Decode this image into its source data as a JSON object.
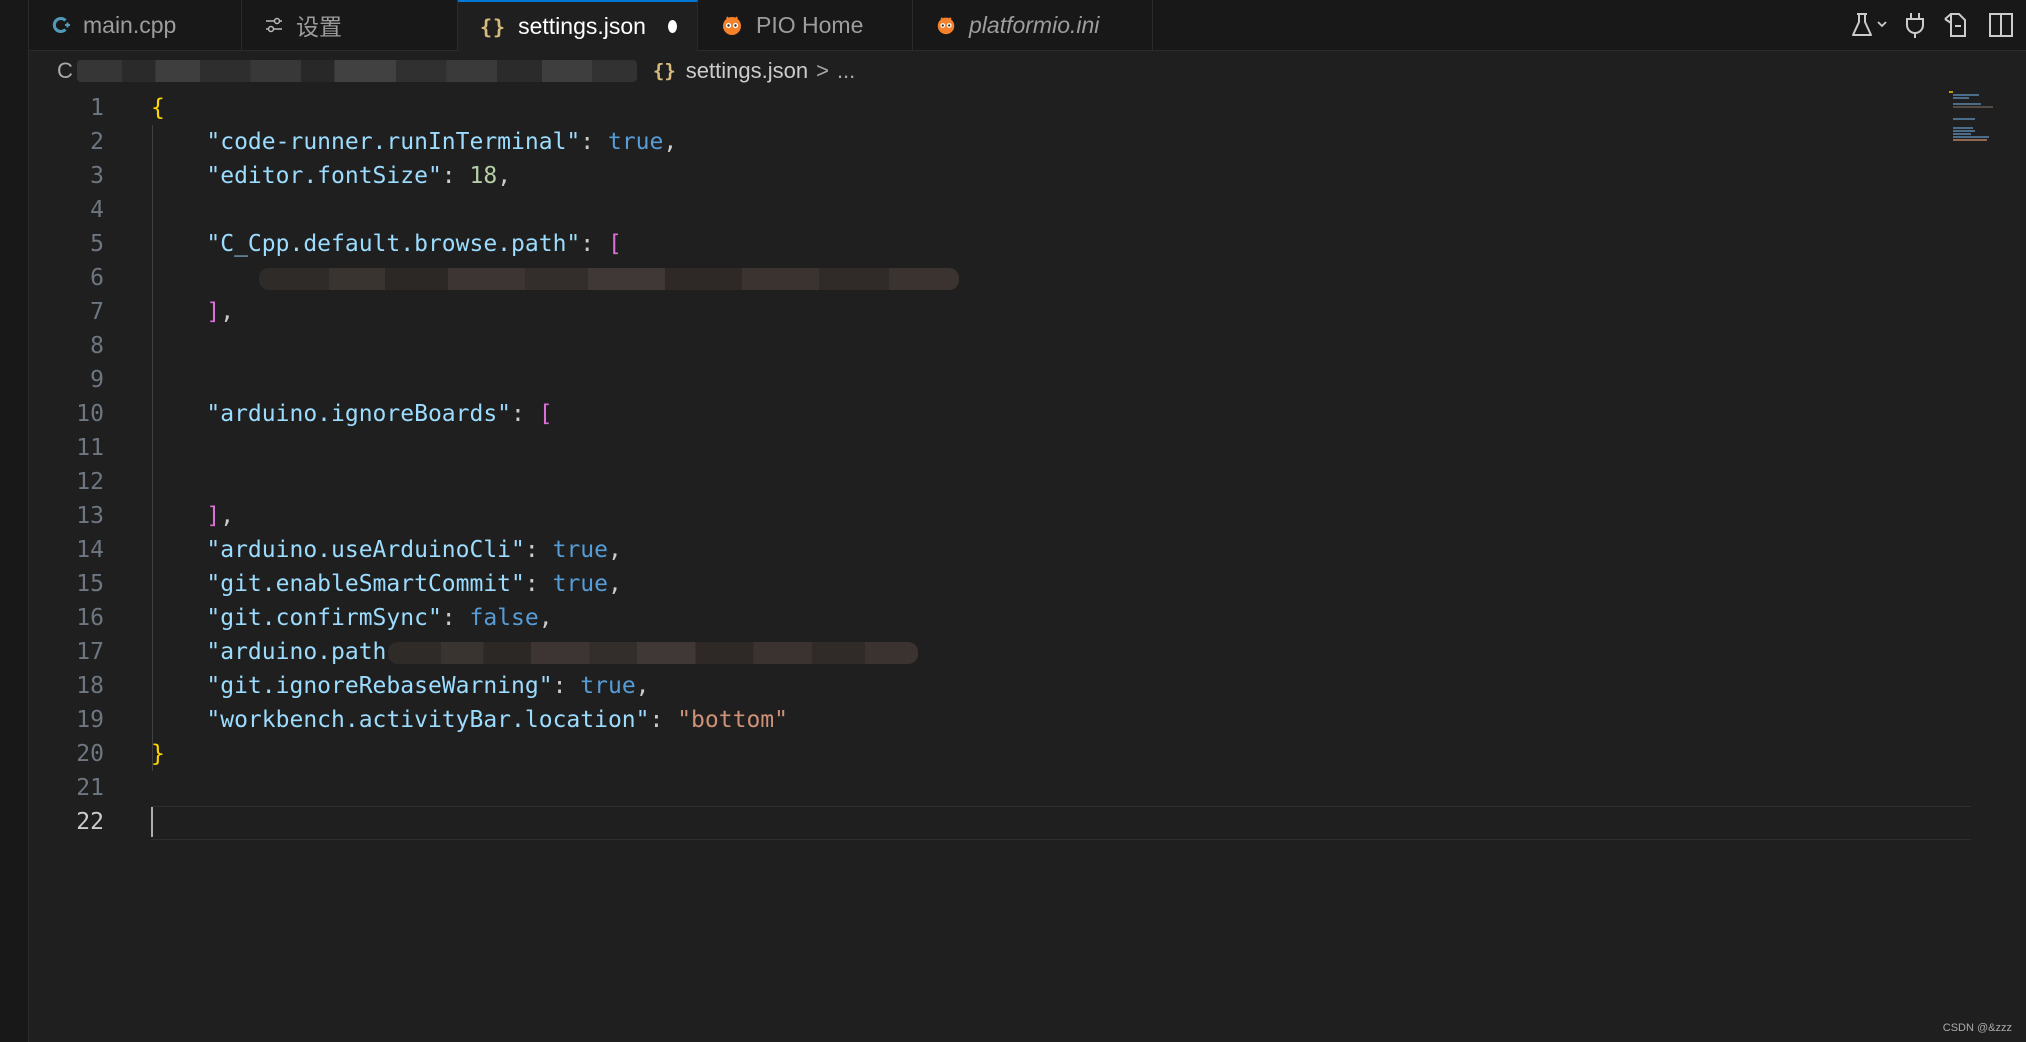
{
  "tabs": [
    {
      "label": "main.cpp",
      "icon": "cpp-icon"
    },
    {
      "label": "设置",
      "icon": "sliders-icon"
    },
    {
      "label": "settings.json",
      "icon": "json-braces-icon",
      "active": true,
      "unsaved": true
    },
    {
      "label": "PIO Home",
      "icon": "platformio-alien-icon"
    },
    {
      "label": "platformio.ini",
      "icon": "platformio-alien-icon"
    }
  ],
  "breadcrumb": {
    "root": "C",
    "file": "settings.json",
    "separator": ">",
    "ellipsis": "..."
  },
  "editor": {
    "line_numbers": [
      "1",
      "2",
      "3",
      "4",
      "5",
      "6",
      "7",
      "8",
      "9",
      "10",
      "11",
      "12",
      "13",
      "14",
      "15",
      "16",
      "17",
      "18",
      "19",
      "20",
      "21",
      "22"
    ],
    "current_line": 22,
    "tokens": {
      "open_brace": "{",
      "close_brace": "}",
      "l2_key": "\"code-runner.runInTerminal\"",
      "l2_val": "true",
      "l3_key": "\"editor.fontSize\"",
      "l3_val": "18",
      "l5_key": "\"C_Cpp.default.browse.path\"",
      "open_bracket": "[",
      "l7_close": "]",
      "l10_key": "\"arduino.ignoreBoards\"",
      "l13_close": "]",
      "l14_key": "\"arduino.useArduinoCli\"",
      "l14_val": "true",
      "l15_key": "\"git.enableSmartCommit\"",
      "l15_val": "true",
      "l16_key": "\"git.confirmSync\"",
      "l16_val": "false",
      "l17_key_partial": "\"arduino.path",
      "l18_key": "\"git.ignoreRebaseWarning\"",
      "l18_val": "true",
      "l19_key": "\"workbench.activityBar.location\"",
      "l19_val": "\"bottom\"",
      "colon": ": ",
      "comma": ","
    }
  },
  "colors": {
    "accent": "#0078d4",
    "json_key": "#9cdcfe",
    "json_bool": "#569cd6",
    "json_number": "#b5cea8",
    "json_string": "#ce9178",
    "brace": "#ffd700",
    "bracket": "#da70d6"
  },
  "actions": [
    {
      "name": "flask-icon"
    },
    {
      "name": "plug-icon"
    },
    {
      "name": "open-changes-icon"
    },
    {
      "name": "split-editor-icon"
    }
  ],
  "watermark": "CSDN @&zzz"
}
